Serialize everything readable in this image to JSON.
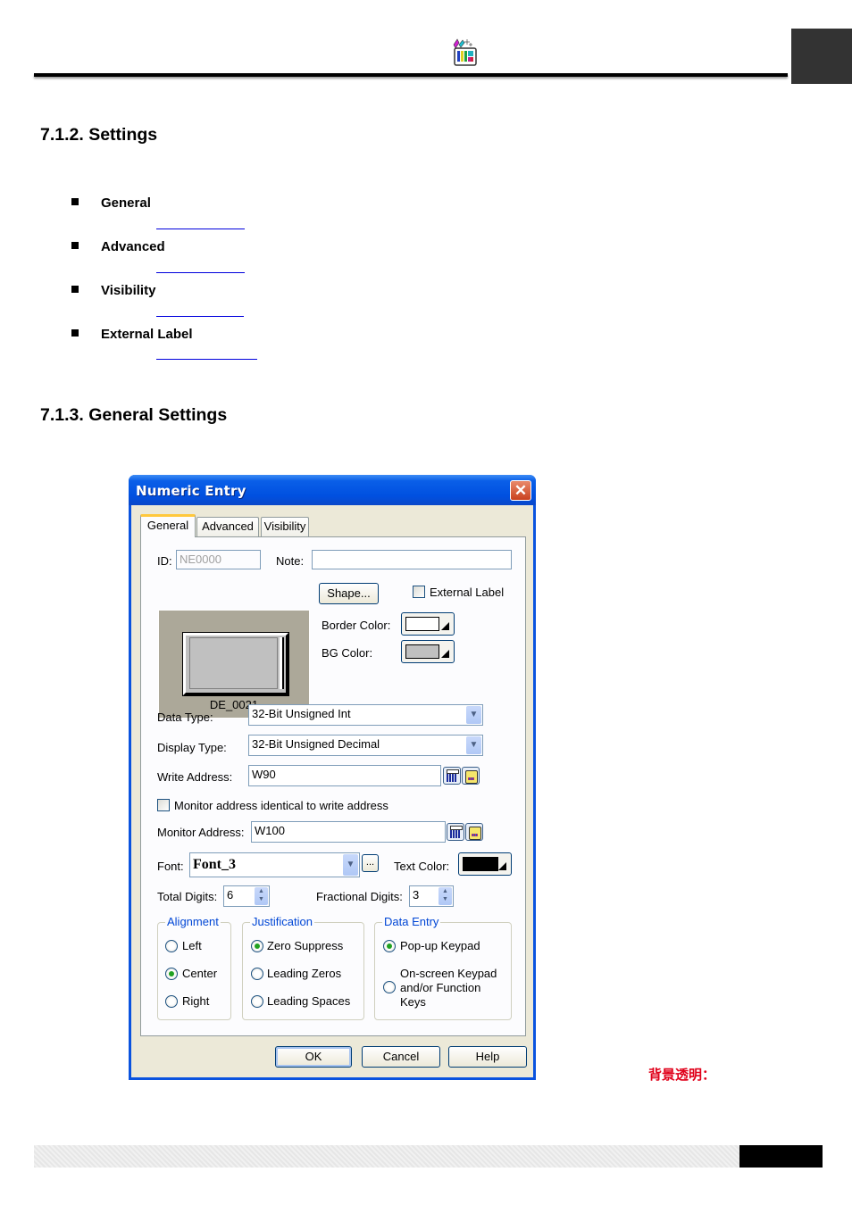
{
  "header": {
    "logo_icon": "palette-tool-icon"
  },
  "sections": [
    {
      "title": "7.1.2. Settings",
      "bullets": [
        {
          "label": "General"
        },
        {
          "label": "Advanced"
        },
        {
          "label": "Visibility"
        },
        {
          "label": "External Label"
        }
      ]
    },
    {
      "title": "7.1.3. General Settings"
    }
  ],
  "dialog": {
    "title": "Numeric Entry",
    "tabs": [
      {
        "label": "General",
        "active": true
      },
      {
        "label": "Advanced",
        "active": false
      },
      {
        "label": "Visibility",
        "active": false
      }
    ],
    "id_label": "ID:",
    "id_value": "NE0000",
    "note_label": "Note:",
    "note_value": "",
    "preview_caption": "DE_0021",
    "shape_button": "Shape...",
    "external_label": {
      "label": "External Label",
      "checked": false
    },
    "border_color": {
      "label": "Border Color:",
      "value": "#ffffff"
    },
    "bg_color": {
      "label": "BG Color:",
      "value": "#c0c0c0"
    },
    "data_type": {
      "label": "Data Type:",
      "value": "32-Bit Unsigned Int"
    },
    "display_type": {
      "label": "Display Type:",
      "value": "32-Bit Unsigned Decimal"
    },
    "write_address": {
      "label": "Write Address:",
      "value": "W90"
    },
    "monitor_identical": {
      "label": "Monitor address identical to write address",
      "checked": false
    },
    "monitor_address": {
      "label": "Monitor Address:",
      "value": "W100"
    },
    "font": {
      "label": "Font:",
      "value": "Font_3",
      "browse": "..."
    },
    "text_color": {
      "label": "Text Color:",
      "value": "#000000"
    },
    "total_digits": {
      "label": "Total Digits:",
      "value": "6"
    },
    "fractional_digits": {
      "label": "Fractional Digits:",
      "value": "3"
    },
    "alignment": {
      "title": "Alignment",
      "options": [
        {
          "label": "Left",
          "selected": false
        },
        {
          "label": "Center",
          "selected": true
        },
        {
          "label": "Right",
          "selected": false
        }
      ]
    },
    "justification": {
      "title": "Justification",
      "options": [
        {
          "label": "Zero Suppress",
          "selected": true
        },
        {
          "label": "Leading Zeros",
          "selected": false
        },
        {
          "label": "Leading Spaces",
          "selected": false
        }
      ]
    },
    "data_entry": {
      "title": "Data Entry",
      "options": [
        {
          "label": "Pop-up Keypad",
          "selected": true
        },
        {
          "label": "On-screen Keypad\nand/or Function\nKeys",
          "line1": "On-screen Keypad",
          "line2": "and/or Function",
          "line3": "Keys",
          "selected": false
        }
      ]
    },
    "buttons": {
      "ok": "OK",
      "cancel": "Cancel",
      "help": "Help"
    }
  },
  "annotation": "背景透明："
}
